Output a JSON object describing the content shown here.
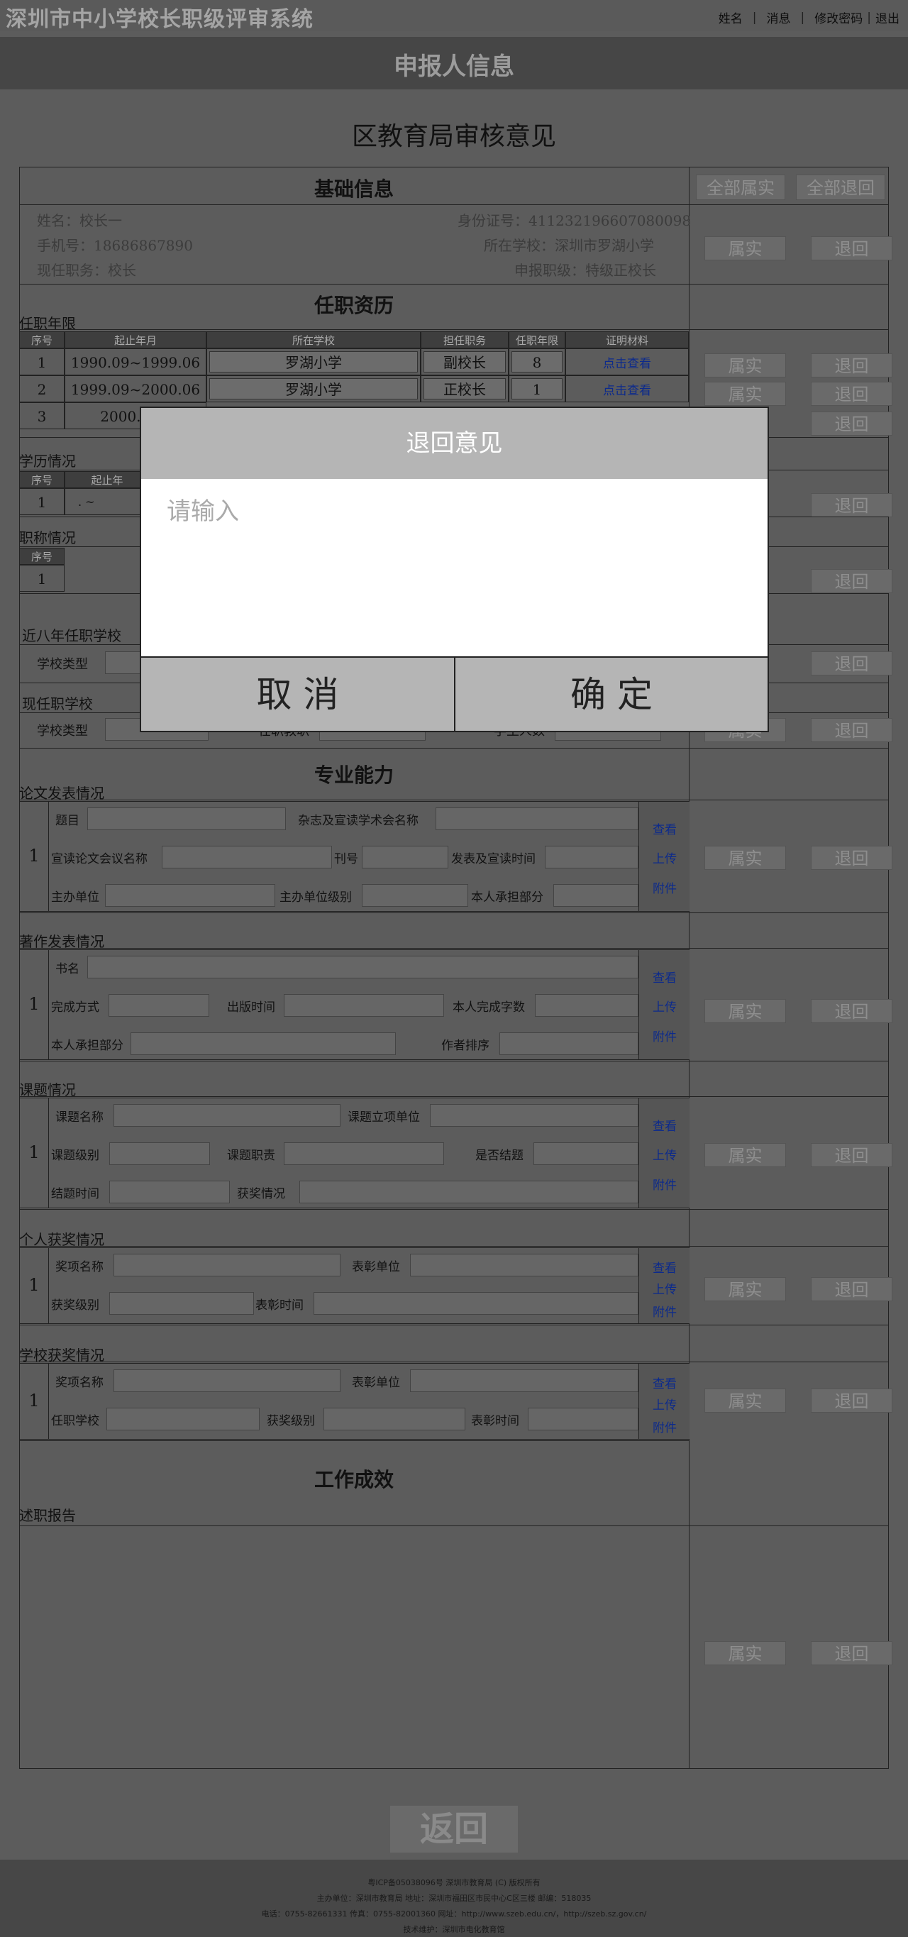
{
  "app": {
    "title": "深圳市中小学校长职级评审系统",
    "nav": [
      "姓名",
      "消息",
      "修改密码",
      "退出"
    ],
    "nav_sep": "|"
  },
  "header": {
    "title": "申报人信息"
  },
  "page": {
    "title": "区教育局审核意见"
  },
  "actions": {
    "all_confirm": "全部属实",
    "all_return": "全部退回",
    "confirm": "属实",
    "return": "退回"
  },
  "basic": {
    "title": "基础信息",
    "name": "姓名：校长一",
    "id": "身份证号：411232196607080098",
    "phone": "手机号：18686867890",
    "school": "所在学校：深圳市罗湖小学",
    "position": "现任职务：校长",
    "level": "申报职级：特级正校长"
  },
  "history": {
    "title": "任职资历",
    "tenure_title": "任职年限",
    "headers": [
      "序号",
      "起止年月",
      "所在学校",
      "担任职务",
      "任职年限",
      "证明材料"
    ],
    "rows": [
      {
        "no": "1",
        "period": "1990.09~1999.06",
        "school": "罗湖小学",
        "role": "副校长",
        "years": "8",
        "proof": "点击查看"
      },
      {
        "no": "2",
        "period": "1999.09~2000.06",
        "school": "罗湖小学",
        "role": "正校长",
        "years": "1",
        "proof": "点击查看"
      },
      {
        "no": "3",
        "period": "2000.09~"
      }
    ],
    "edu_title": "学历情况",
    "edu_headers": [
      "序号",
      "起止年"
    ],
    "edu_row_no": "1",
    "edu_row_value": ". ~",
    "rank_title": "职称情况",
    "rank_headers": [
      "序号"
    ],
    "rank_row_no": "1",
    "eight_title": "近八年任职学校",
    "eight_label": "学校类型",
    "cur_title": "现任职学校",
    "cur_label": "学校类型",
    "cur_label2": "在职教职",
    "cur_label3": "学生人数"
  },
  "ability": {
    "title": "专业能力",
    "paper": {
      "title": "论文发表情况",
      "no": "1",
      "l_title": "题目",
      "l_mag": "杂志及宣读学术会名称",
      "l_conf": "宣读论文会议名称",
      "l_issue": "刊号",
      "l_time": "发表及宣读时间",
      "l_org": "主办单位",
      "l_orglvl": "主办单位级别",
      "l_part": "本人承担部分"
    },
    "book": {
      "title": "著作发表情况",
      "no": "1",
      "l_name": "书名",
      "l_mode": "完成方式",
      "l_pub": "出版时间",
      "l_words": "本人完成字数",
      "l_part": "本人承担部分",
      "l_rank": "作者排序"
    },
    "topic": {
      "title": "课题情况",
      "no": "1",
      "l_name": "课题名称",
      "l_unit": "课题立项单位",
      "l_level": "课题级别",
      "l_role": "课题职责",
      "l_done": "是否结题",
      "l_end": "结题时间",
      "l_award": "获奖情况"
    },
    "personal": {
      "title": "个人获奖情况",
      "no": "1",
      "l_name": "奖项名称",
      "l_unit": "表彰单位",
      "l_level": "获奖级别",
      "l_time": "表彰时间"
    },
    "school": {
      "title": "学校获奖情况",
      "no": "1",
      "l_name": "奖项名称",
      "l_unit": "表彰单位",
      "l_sch": "任职学校",
      "l_level": "获奖级别",
      "l_time": "表彰时间"
    },
    "side": {
      "view": "查看",
      "upload": "上传",
      "attach": "附件"
    }
  },
  "results": {
    "title": "工作成效",
    "report_title": "述职报告"
  },
  "back": "返回",
  "footer": {
    "lines": [
      "粤ICP备05038096号 深圳市教育局 (C) 版权所有",
      "主办单位：深圳市教育局 地址：深圳市福田区市民中心C区三楼 邮编：518035",
      "电话：0755-82661331 传真：0755-82001360 网址：http://www.szeb.edu.cn/，http://szeb.sz.gov.cn/",
      "技术维护：深圳市电化教育馆"
    ]
  },
  "modal": {
    "title": "退回意见",
    "placeholder": "请输入",
    "cancel": "取  消",
    "ok": "确    定"
  }
}
